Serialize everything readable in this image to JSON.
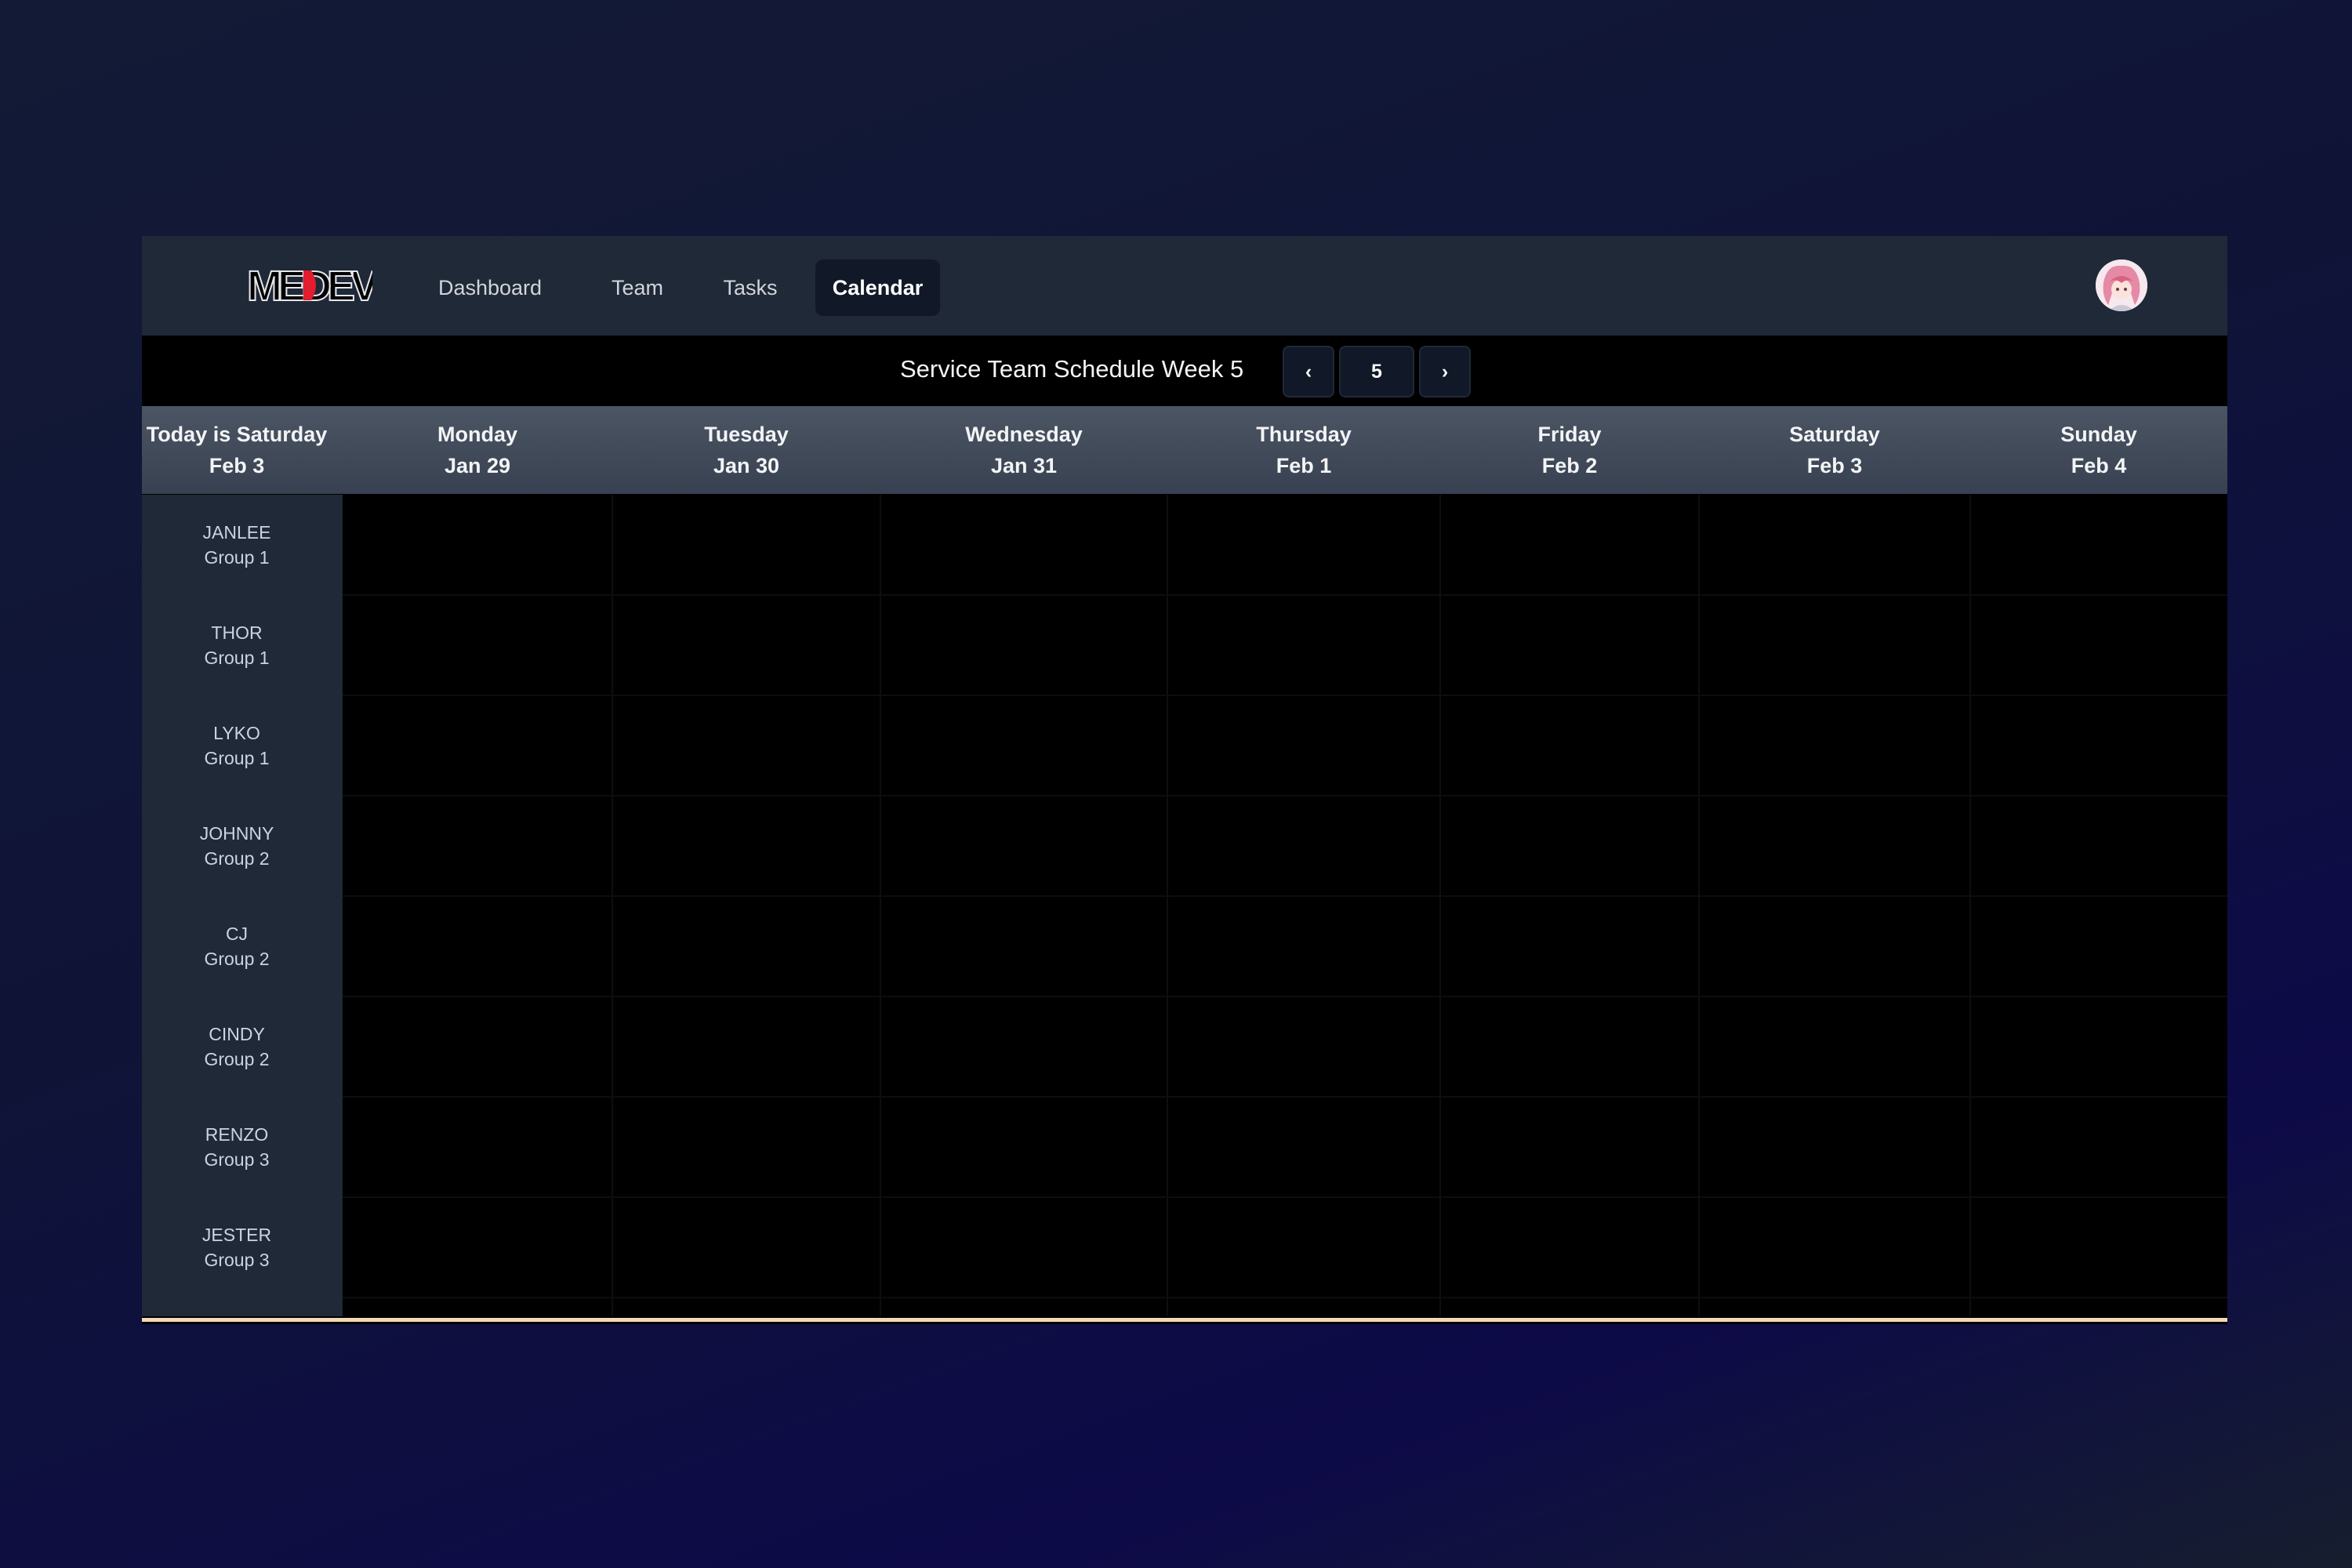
{
  "nav": {
    "logo_text": "MEDEV",
    "links": [
      {
        "label": "Dashboard",
        "active": false
      },
      {
        "label": "Team",
        "active": false
      },
      {
        "label": "Tasks",
        "active": false
      },
      {
        "label": "Calendar",
        "active": true
      }
    ],
    "avatar_icon": "user-avatar-icon"
  },
  "schedule": {
    "title": "Service Team Schedule Week 5",
    "prev_label": "‹",
    "week_number": "5",
    "next_label": "›"
  },
  "header": {
    "today_line1": "Today is Saturday",
    "today_line2": "Feb 3",
    "days": [
      {
        "day": "Monday",
        "date": "Jan 29"
      },
      {
        "day": "Tuesday",
        "date": "Jan 30"
      },
      {
        "day": "Wednesday",
        "date": "Jan 31"
      },
      {
        "day": "Thursday",
        "date": "Feb 1"
      },
      {
        "day": "Friday",
        "date": "Feb 2"
      },
      {
        "day": "Saturday",
        "date": "Feb 3"
      },
      {
        "day": "Sunday",
        "date": "Feb 4"
      }
    ]
  },
  "members": [
    {
      "name": "JANLEE",
      "group": "Group 1"
    },
    {
      "name": "THOR",
      "group": "Group 1"
    },
    {
      "name": "LYKO",
      "group": "Group 1"
    },
    {
      "name": "JOHNNY",
      "group": "Group 2"
    },
    {
      "name": "CJ",
      "group": "Group 2"
    },
    {
      "name": "CINDY",
      "group": "Group 2"
    },
    {
      "name": "RENZO",
      "group": "Group 3"
    },
    {
      "name": "JESTER",
      "group": "Group 3"
    }
  ],
  "colors": {
    "nav_bg": "#1f2937",
    "active_tab_bg": "#111827",
    "header_bg": "#4b5563",
    "accent_line": "#f3d9b8",
    "logo_red": "#e11d2e"
  }
}
